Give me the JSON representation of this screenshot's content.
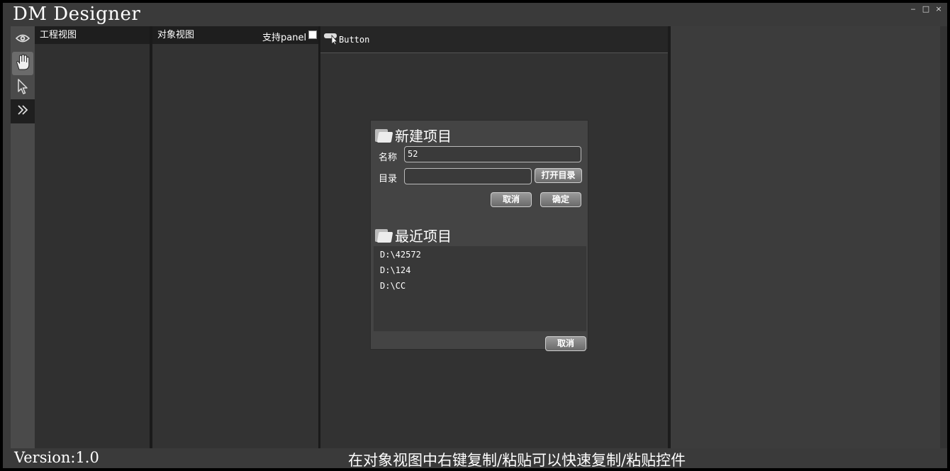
{
  "app": {
    "title": "DM Designer"
  },
  "window_controls": {
    "minimize": "‒",
    "maximize": "□",
    "close": "×"
  },
  "toolbar": {
    "items": [
      {
        "icon": "eye-icon"
      },
      {
        "icon": "hand-icon",
        "active": true
      },
      {
        "icon": "pointer-icon"
      },
      {
        "icon": "double-chevron-right-icon"
      }
    ]
  },
  "panels": {
    "project_view": "工程视图",
    "object_view": "对象视图",
    "support_panel_label": "支持panel",
    "support_panel_checked": false
  },
  "components": {
    "button_label": "Button"
  },
  "dialog": {
    "new_project_title": "新建项目",
    "name_label": "名称",
    "name_value": "52",
    "dir_label": "目录",
    "dir_value": "",
    "open_dir_button": "打开目录",
    "cancel_button": "取消",
    "ok_button": "确定",
    "recent_title": "最近项目",
    "recent_items": [
      "D:\\42572",
      "D:\\124",
      "D:\\CC"
    ],
    "recent_cancel_button": "取消"
  },
  "status": {
    "version": "Version:1.0",
    "hint": "在对象视图中右键复制/粘贴可以快速复制/粘贴控件"
  }
}
